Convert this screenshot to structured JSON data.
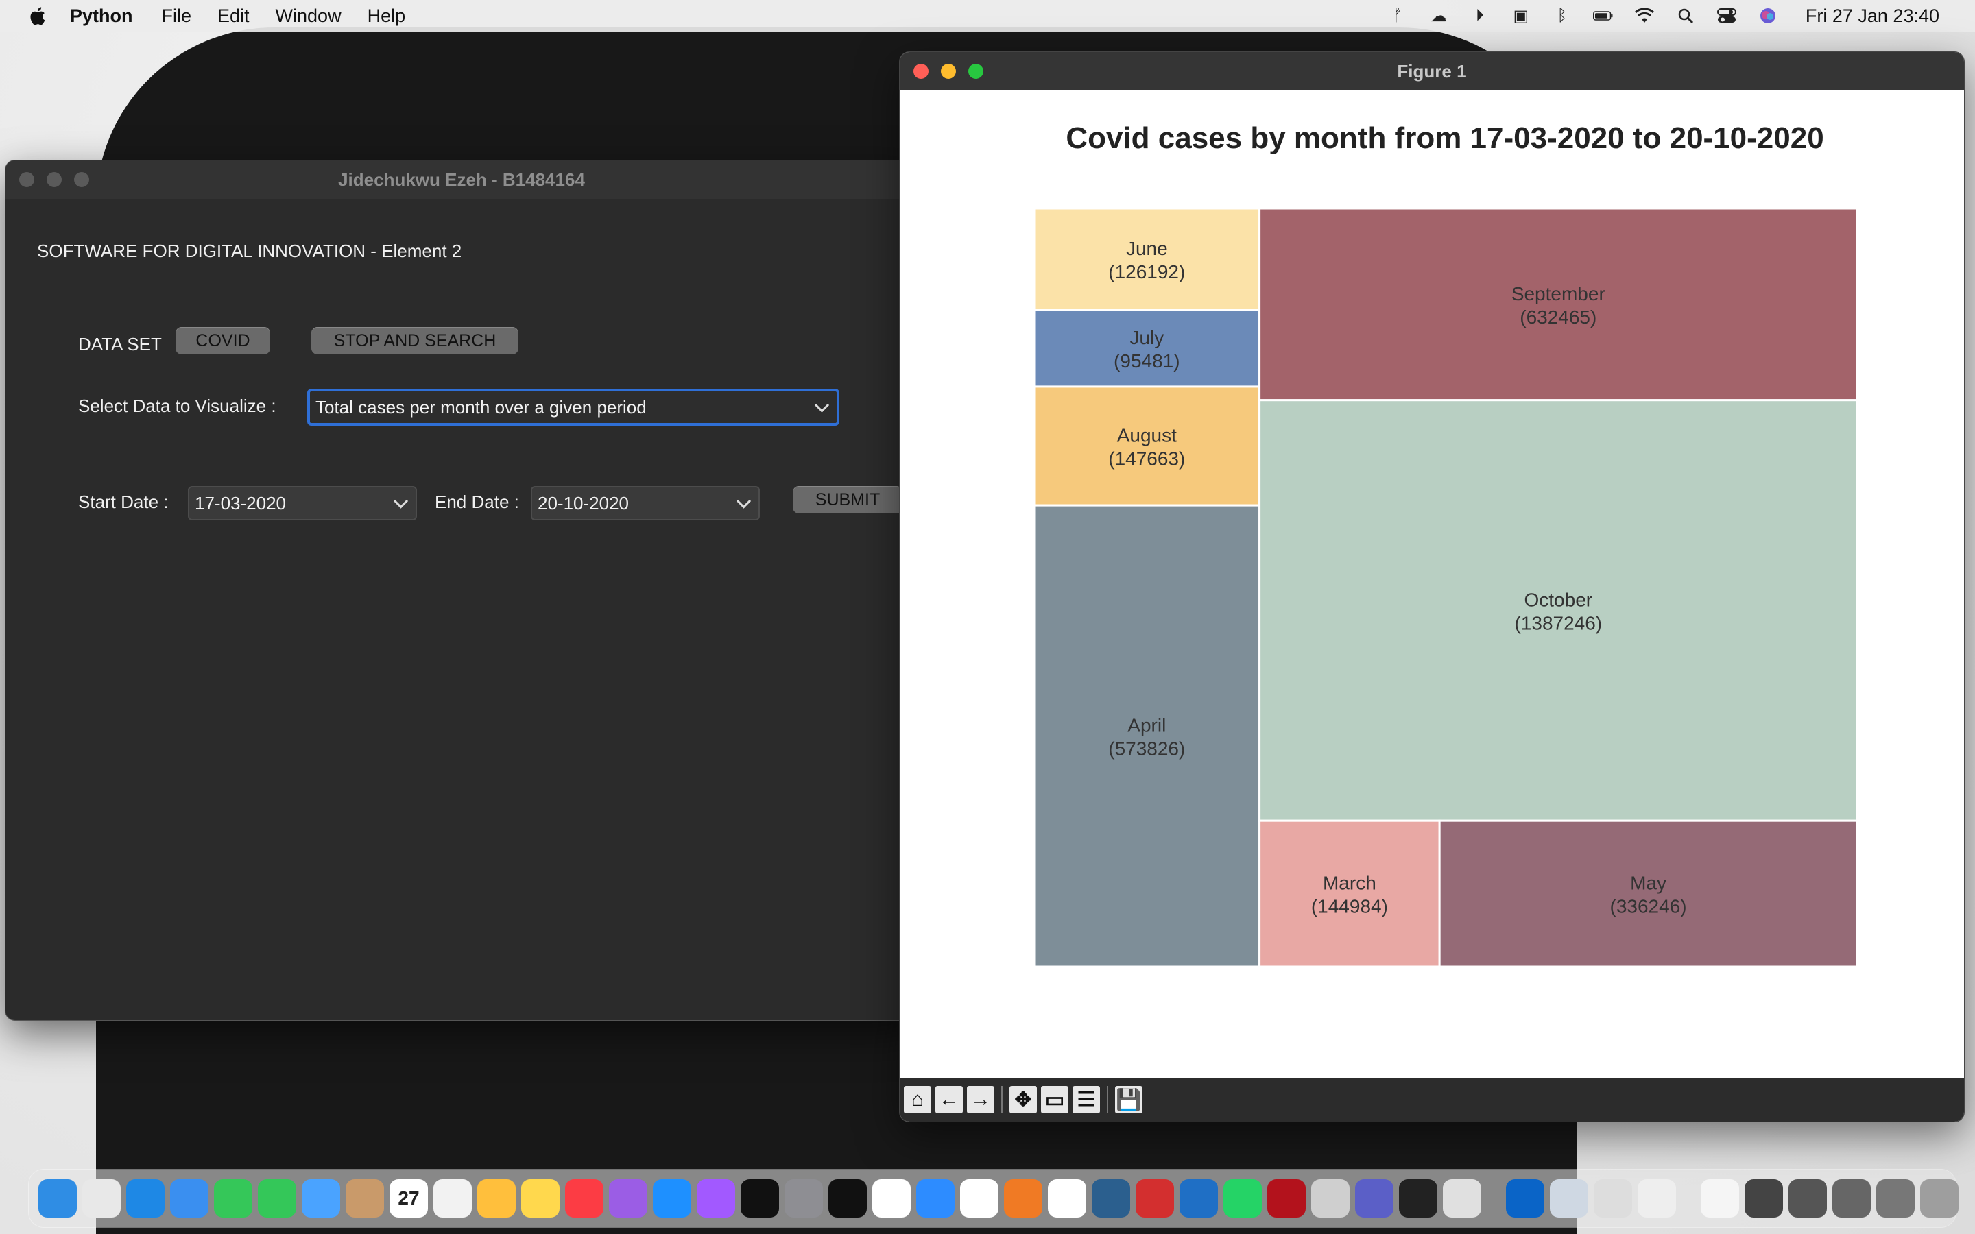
{
  "menubar": {
    "app_name": "Python",
    "menus": [
      "File",
      "Edit",
      "Window",
      "Help"
    ],
    "clock": "Fri 27 Jan  23:40"
  },
  "left_window": {
    "title": "Jidechukwu Ezeh - B1484164",
    "heading": "SOFTWARE FOR DIGITAL INNOVATION - Element 2",
    "dataset_label": "DATA SET",
    "covid_button": "COVID",
    "stop_search_button": "STOP AND SEARCH",
    "select_label": "Select Data to Visualize :",
    "select_value": "Total cases per month over a given period",
    "start_label": "Start Date :",
    "start_value": "17-03-2020",
    "end_label": "End Date :",
    "end_value": "20-10-2020",
    "submit_button": "SUBMIT"
  },
  "figure_window": {
    "title": "Figure 1",
    "toolbar_icons": [
      "home-icon",
      "back-arrow-icon",
      "forward-arrow-icon",
      "pan-icon",
      "zoom-icon",
      "configure-subplots-icon",
      "save-icon"
    ]
  },
  "chart_data": {
    "type": "treemap",
    "title": "Covid cases by month from 17-03-2020 to 20-10-2020",
    "items": [
      {
        "label": "June",
        "value": 126192,
        "value_label": "(126192)",
        "color": "#fbe2a8"
      },
      {
        "label": "July",
        "value": 95481,
        "value_label": "(95481)",
        "color": "#6b8ab8"
      },
      {
        "label": "August",
        "value": 147663,
        "value_label": "(147663)",
        "color": "#f6c97c"
      },
      {
        "label": "April",
        "value": 573826,
        "value_label": "(573826)",
        "color": "#7e8e98"
      },
      {
        "label": "September",
        "value": 632465,
        "value_label": "(632465)",
        "color": "#a3636a"
      },
      {
        "label": "October",
        "value": 1387246,
        "value_label": "(1387246)",
        "color": "#b8cfc2"
      },
      {
        "label": "March",
        "value": 144984,
        "value_label": "(144984)",
        "color": "#e8a8a4"
      },
      {
        "label": "May",
        "value": 336246,
        "value_label": "(336246)",
        "color": "#956a76"
      }
    ]
  },
  "dock": {
    "apps": [
      "finder-icon",
      "launchpad-icon",
      "safari-icon",
      "mail-icon",
      "facetime-icon",
      "messages-icon",
      "maps-icon",
      "contacts-icon",
      "calendar-icon",
      "reminders-icon",
      "photos-icon",
      "notes-icon",
      "music-icon",
      "podcasts-icon",
      "app-store-icon",
      "feedback-icon",
      "tv-icon",
      "system-settings-icon",
      "binance-icon",
      "figma-icon",
      "zoom-icon",
      "slack-icon",
      "pages-icon",
      "chrome-icon",
      "mysql-icon",
      "parallels-icon",
      "vscode-icon",
      "whatsapp-icon",
      "filezilla-icon",
      "python-launcher-icon",
      "teams-icon",
      "activity-icon",
      "parallels-desktop-icon",
      "outlook-icon",
      "preview-icon",
      "finder-window-icon",
      "plugin-icon",
      "document-icon",
      "window-thumb-1-icon",
      "window-thumb-2-icon",
      "window-thumb-3-icon",
      "window-thumb-4-icon",
      "trash-icon"
    ],
    "calendar_day": "27"
  }
}
